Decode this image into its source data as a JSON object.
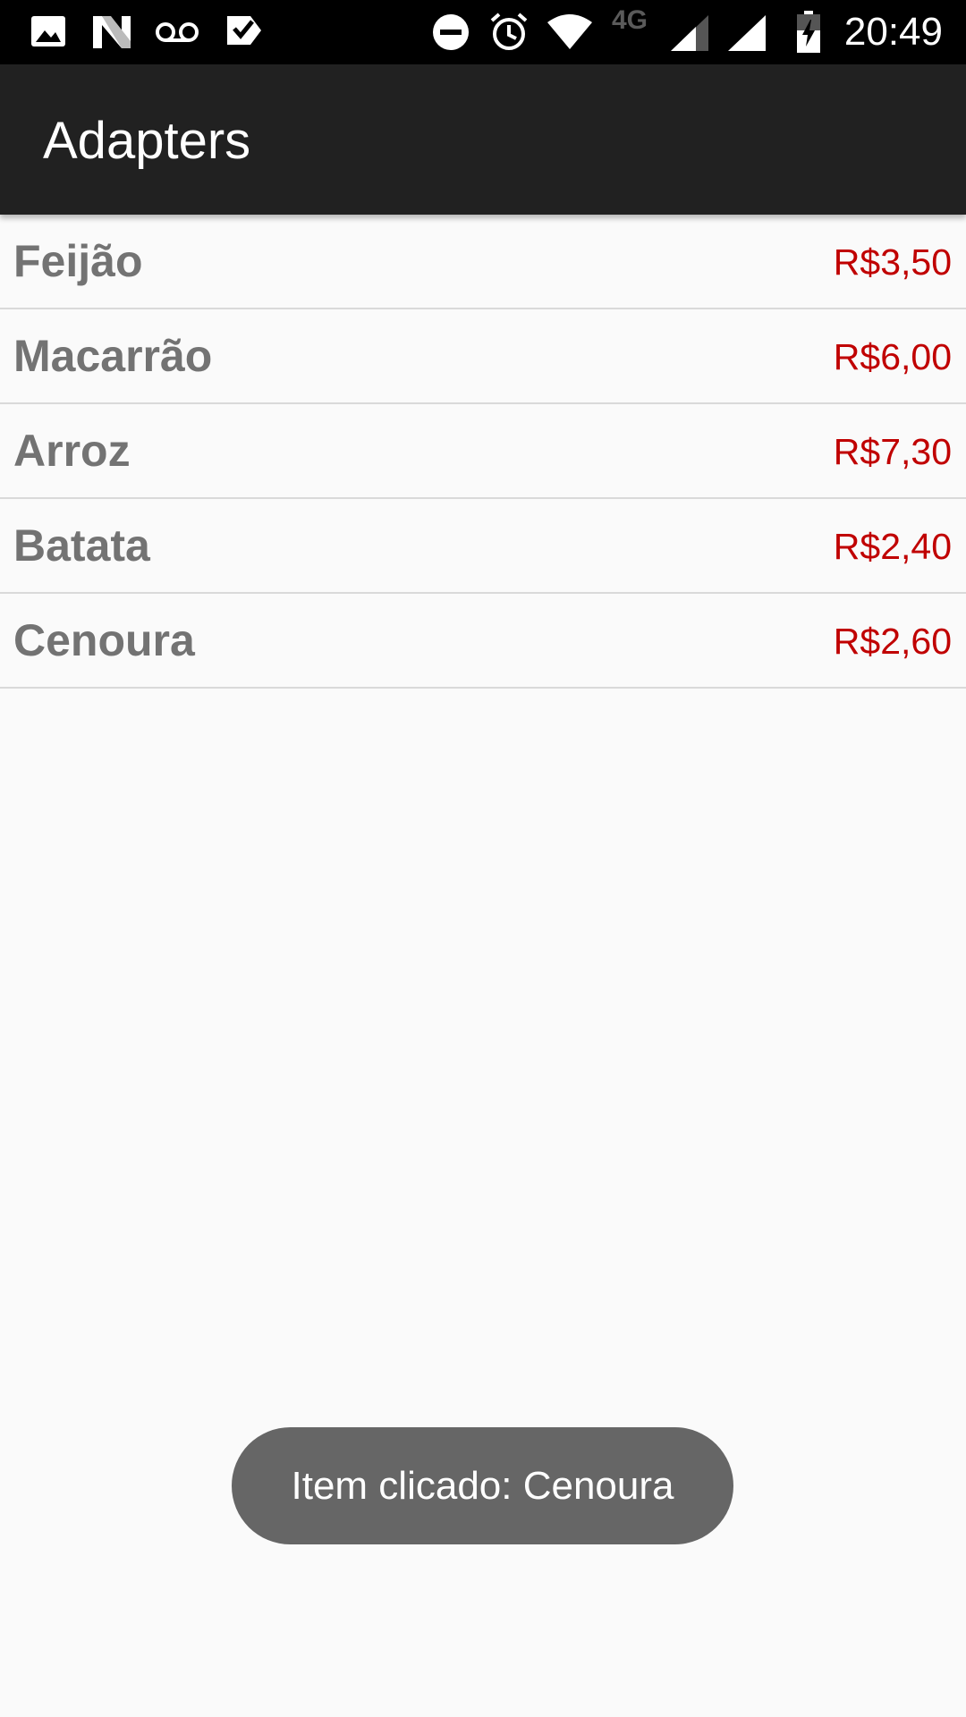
{
  "status_bar": {
    "time": "20:49",
    "network_label": "4G",
    "icons": [
      "image-icon",
      "n-logo-icon",
      "voicemail-icon",
      "check-flag-icon",
      "do-not-disturb-icon",
      "alarm-icon",
      "wifi-icon",
      "signal-icon",
      "signal-full-icon",
      "battery-charging-icon"
    ]
  },
  "app_bar": {
    "title": "Adapters"
  },
  "items": [
    {
      "name": "Feijão",
      "price": "R$3,50"
    },
    {
      "name": "Macarrão",
      "price": "R$6,00"
    },
    {
      "name": "Arroz",
      "price": "R$7,30"
    },
    {
      "name": "Batata",
      "price": "R$2,40"
    },
    {
      "name": "Cenoura",
      "price": "R$2,60"
    }
  ],
  "toast": {
    "message": "Item clicado: Cenoura"
  },
  "colors": {
    "app_bar": "#212121",
    "background": "#fafafa",
    "item_name": "#737373",
    "price": "#c00000",
    "toast": "#666666"
  }
}
